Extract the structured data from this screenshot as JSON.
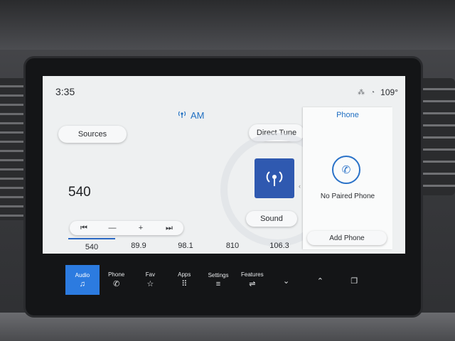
{
  "clock": "3:35",
  "status": {
    "temperature": "109°",
    "icons": [
      "phone-signal-icon",
      "wifi-icon"
    ]
  },
  "band": {
    "label": "AM",
    "icon": "antenna-icon"
  },
  "sources_label": "Sources",
  "direct_tune_label": "Direct Tune",
  "frequency": "540",
  "sound_label": "Sound",
  "controls": {
    "prev": "⏮",
    "minus": "—",
    "plus": "+",
    "next": "⏭"
  },
  "presets": [
    {
      "label": "540",
      "active": true
    },
    {
      "label": "89.9"
    },
    {
      "label": "98.1"
    },
    {
      "label": "810"
    },
    {
      "label": "106.3"
    }
  ],
  "phone": {
    "title": "Phone",
    "message": "No Paired Phone",
    "add_label": "Add Phone"
  },
  "nav": [
    {
      "label": "Audio",
      "icon": "♫",
      "active": true
    },
    {
      "label": "Phone",
      "icon": "✆"
    },
    {
      "label": "Fav",
      "icon": "☆"
    },
    {
      "label": "Apps",
      "icon": "⠿"
    },
    {
      "label": "Settings",
      "icon": "≡"
    },
    {
      "label": "Features",
      "icon": "⇌"
    },
    {
      "label": "",
      "icon": "⌄"
    },
    {
      "label": "",
      "icon": "⌃"
    },
    {
      "label": "",
      "icon": "❐"
    }
  ],
  "colors": {
    "accent": "#2c7be0",
    "station_art": "#2f59b0"
  }
}
